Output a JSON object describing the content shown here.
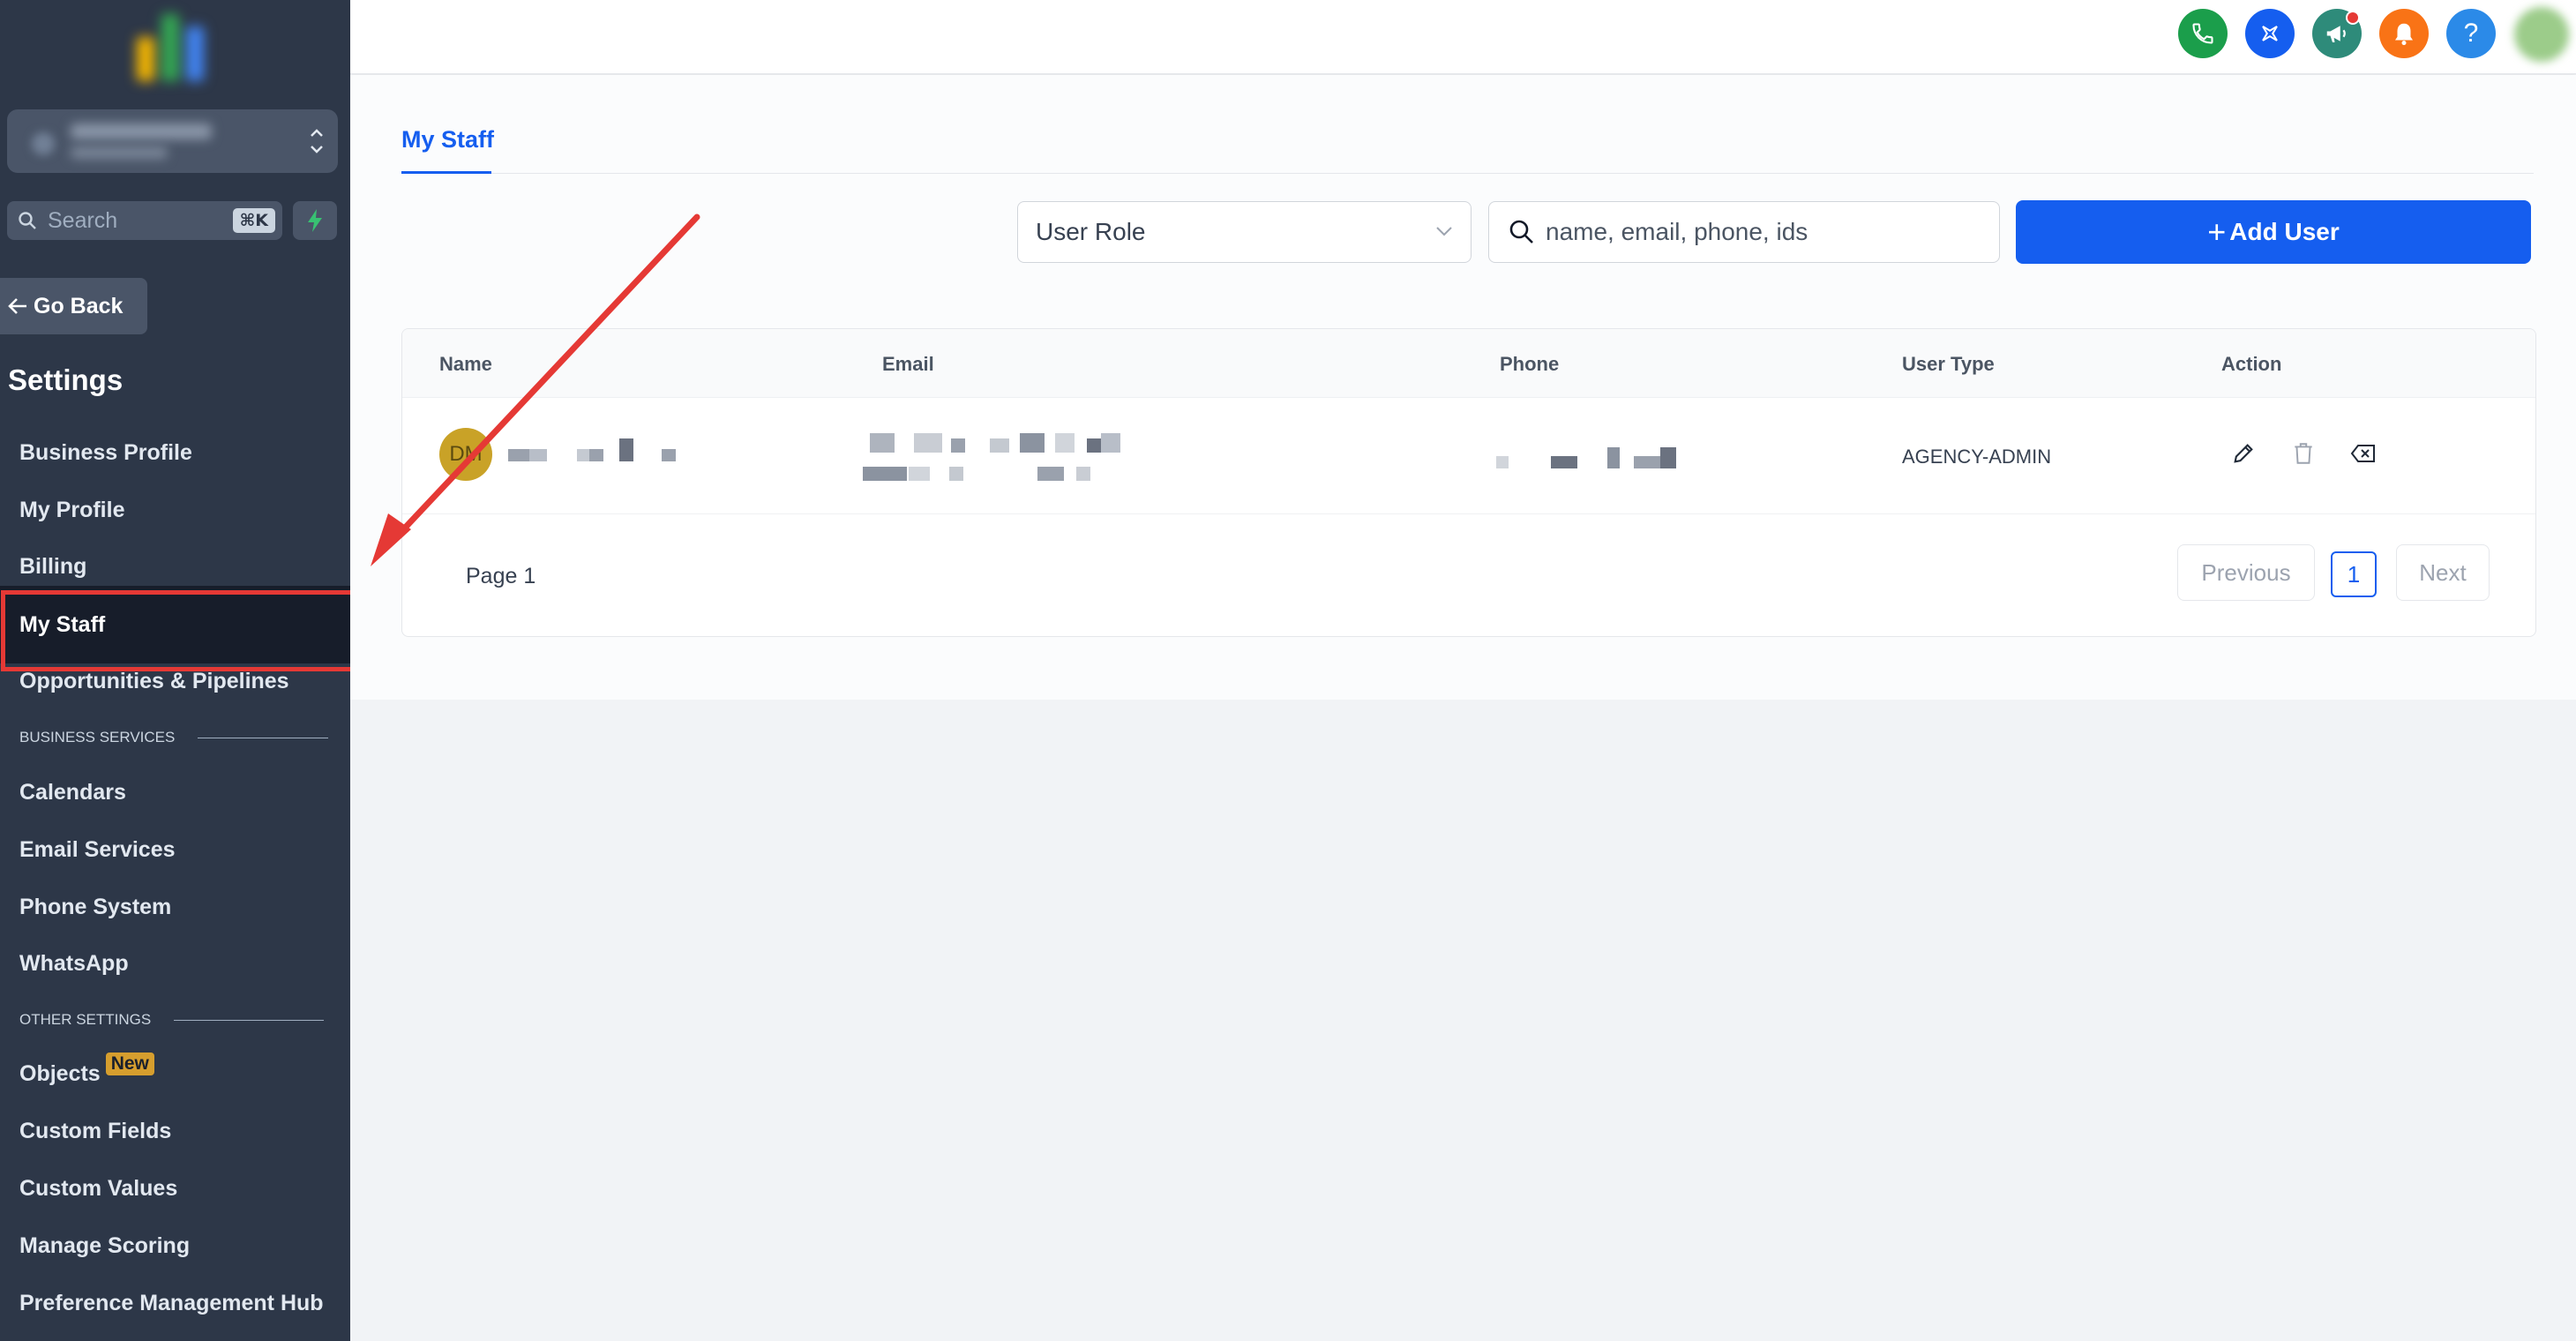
{
  "sidebar": {
    "search_placeholder": "Search",
    "search_shortcut": "⌘K",
    "go_back": "Go Back",
    "settings_title": "Settings",
    "items_top": [
      "Business Profile",
      "My Profile",
      "Billing",
      "My Staff",
      "Opportunities & Pipelines"
    ],
    "section_business": "BUSINESS SERVICES",
    "items_business": [
      "Calendars",
      "Email Services",
      "Phone System",
      "WhatsApp"
    ],
    "section_other": "OTHER SETTINGS",
    "items_other": [
      "Objects",
      "Custom Fields",
      "Custom Values",
      "Manage Scoring",
      "Preference Management Hub"
    ],
    "objects_badge": "New",
    "active_item": "My Staff"
  },
  "topbar": {
    "icons": [
      "phone-icon",
      "sparkle-icon",
      "megaphone-icon",
      "bell-icon",
      "help-icon"
    ],
    "colors": {
      "phone": "#1b9e4b",
      "sparkle": "#155eef",
      "megaphone": "#2e8b7a",
      "bell": "#f97316",
      "help": "#2b8ae8"
    },
    "help_label": "?"
  },
  "main": {
    "tab": "My Staff",
    "role_select": "User Role",
    "search_placeholder": "name, email, phone, ids",
    "add_user": "Add User",
    "table": {
      "columns": [
        "Name",
        "Email",
        "Phone",
        "User Type",
        "Action"
      ],
      "rows": [
        {
          "initials": "DM",
          "user_type": "AGENCY-ADMIN"
        }
      ]
    },
    "pagination": {
      "page_label": "Page 1",
      "previous": "Previous",
      "current": "1",
      "next": "Next"
    }
  },
  "colors": {
    "accent": "#155eef",
    "sidebar": "#2d3748",
    "highlight": "#e53935"
  }
}
